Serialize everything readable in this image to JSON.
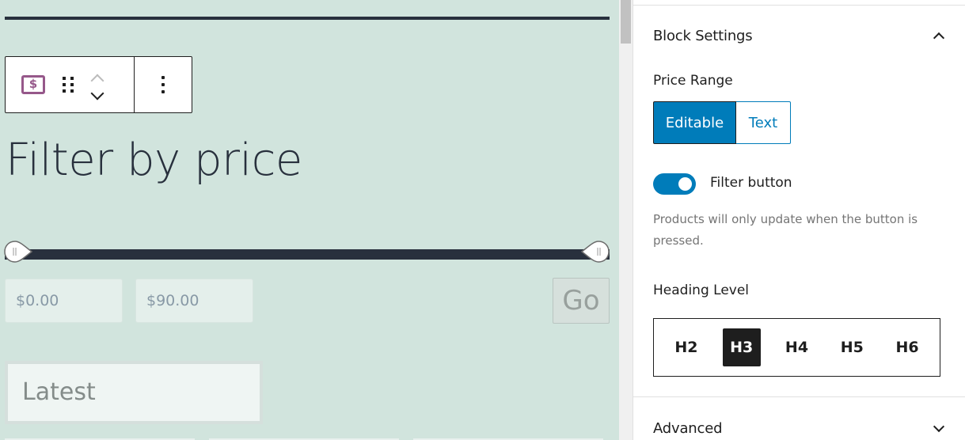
{
  "editor": {
    "toolbar": {
      "block_icon": "price-filter-dollar-icon",
      "block_icon_glyph": "$",
      "drag_icon": "drag-handle-icon",
      "move_up_icon": "chevron-up-icon",
      "move_down_icon": "chevron-down-icon",
      "more_icon": "more-vertical-icon"
    },
    "block_title": "Filter by price",
    "slider": {
      "min_value": 0,
      "max_value": 90,
      "range_min": 0,
      "range_max": 90
    },
    "min_price": "$0.00",
    "max_price": "$90.00",
    "go_label": "Go",
    "sort_select_value": "Latest",
    "colors": {
      "canvas_bg": "#d1e4dd",
      "text_dark": "#28303d",
      "block_icon": "#96588a"
    }
  },
  "sidebar": {
    "block_settings": {
      "title": "Block Settings",
      "expanded": true,
      "price_range_label": "Price Range",
      "price_range_options": [
        "Editable",
        "Text"
      ],
      "price_range_selected": "Editable",
      "filter_button_label": "Filter button",
      "filter_button_enabled": true,
      "filter_button_help": "Products will only update when the button is pressed.",
      "heading_level_label": "Heading Level",
      "heading_levels": [
        "H2",
        "H3",
        "H4",
        "H5",
        "H6"
      ],
      "heading_selected": "H3"
    },
    "advanced": {
      "title": "Advanced",
      "expanded": false
    },
    "colors": {
      "accent": "#007cba",
      "text": "#1e1e1e",
      "help": "#757575"
    }
  }
}
